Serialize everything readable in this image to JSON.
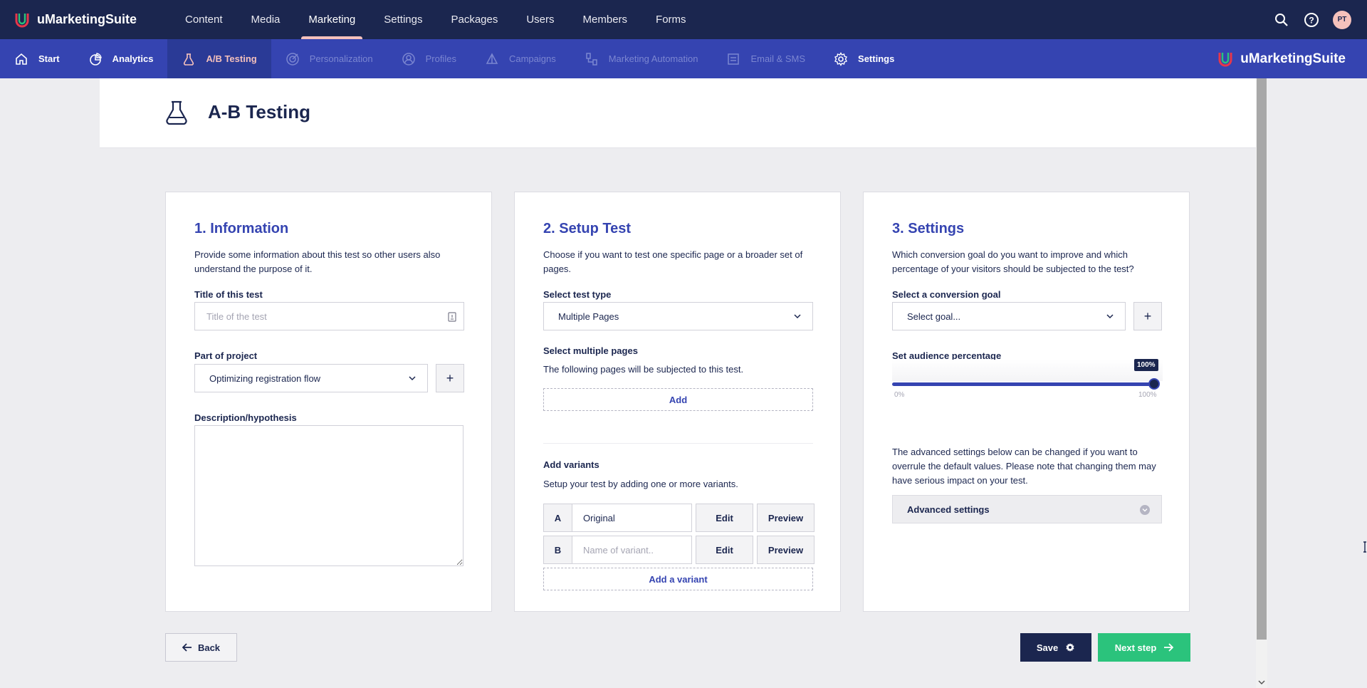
{
  "app": {
    "brand": "uMarketingSuite"
  },
  "topnav": {
    "items": [
      {
        "label": "Content"
      },
      {
        "label": "Media"
      },
      {
        "label": "Marketing"
      },
      {
        "label": "Settings"
      },
      {
        "label": "Packages"
      },
      {
        "label": "Users"
      },
      {
        "label": "Members"
      },
      {
        "label": "Forms"
      }
    ],
    "active": "Marketing",
    "user_initials": "PT"
  },
  "subnav": {
    "items": [
      {
        "label": "Start",
        "icon": "home-icon",
        "state": "normal"
      },
      {
        "label": "Analytics",
        "icon": "pie-chart-icon",
        "state": "normal"
      },
      {
        "label": "A/B Testing",
        "icon": "flask-icon",
        "state": "active"
      },
      {
        "label": "Personalization",
        "icon": "target-icon",
        "state": "disabled"
      },
      {
        "label": "Profiles",
        "icon": "profile-icon",
        "state": "disabled"
      },
      {
        "label": "Campaigns",
        "icon": "campaign-icon",
        "state": "disabled"
      },
      {
        "label": "Marketing Automation",
        "icon": "automation-icon",
        "state": "disabled"
      },
      {
        "label": "Email & SMS",
        "icon": "email-icon",
        "state": "disabled"
      },
      {
        "label": "Settings",
        "icon": "gear-icon",
        "state": "normal"
      }
    ],
    "brand": "uMarketingSuite"
  },
  "page": {
    "title": "A-B Testing"
  },
  "info": {
    "heading": "1. Information",
    "description": "Provide some information about this test so other users also understand the purpose of it.",
    "title_label": "Title of this test",
    "title_placeholder": "Title of the test",
    "project_label": "Part of project",
    "project_value": "Optimizing registration flow",
    "project_add": "+",
    "description_label": "Description/hypothesis"
  },
  "setup": {
    "heading": "2. Setup Test",
    "description": "Choose if you want to test one specific page or a broader set of pages.",
    "type_label": "Select test type",
    "type_value": "Multiple Pages",
    "pages_label": "Select multiple pages",
    "pages_desc": "The following pages will be subjected to this test.",
    "add_label": "Add",
    "variants_label": "Add variants",
    "variants_desc": "Setup your test by adding one or more variants.",
    "variants": [
      {
        "letter": "A",
        "name": "Original",
        "placeholder": false
      },
      {
        "letter": "B",
        "name": "Name of variant..",
        "placeholder": true
      }
    ],
    "edit_label": "Edit",
    "preview_label": "Preview",
    "add_variant_label": "Add a variant"
  },
  "settings": {
    "heading": "3. Settings",
    "description": "Which conversion goal do you want to improve and which percentage of your visitors should be subjected to the test?",
    "goal_label": "Select a conversion goal",
    "goal_placeholder": "Select goal...",
    "goal_add": "+",
    "audience_label": "Set audience percentage",
    "audience_value": "100%",
    "audience_fraction": 1.0,
    "slider_min": "0%",
    "slider_max": "100%",
    "advanced_desc": "The advanced settings below can be changed if you want to overrule the default values. Please note that changing them may have serious impact on your test.",
    "advanced_label": "Advanced settings"
  },
  "footer": {
    "back": "Back",
    "save": "Save",
    "next": "Next step"
  },
  "colors": {
    "topbar": "#1b264f",
    "subbar": "#3544b1",
    "accent": "#3544b1",
    "active_highlight": "#f5c1bc",
    "next_button": "#2bc37c"
  }
}
